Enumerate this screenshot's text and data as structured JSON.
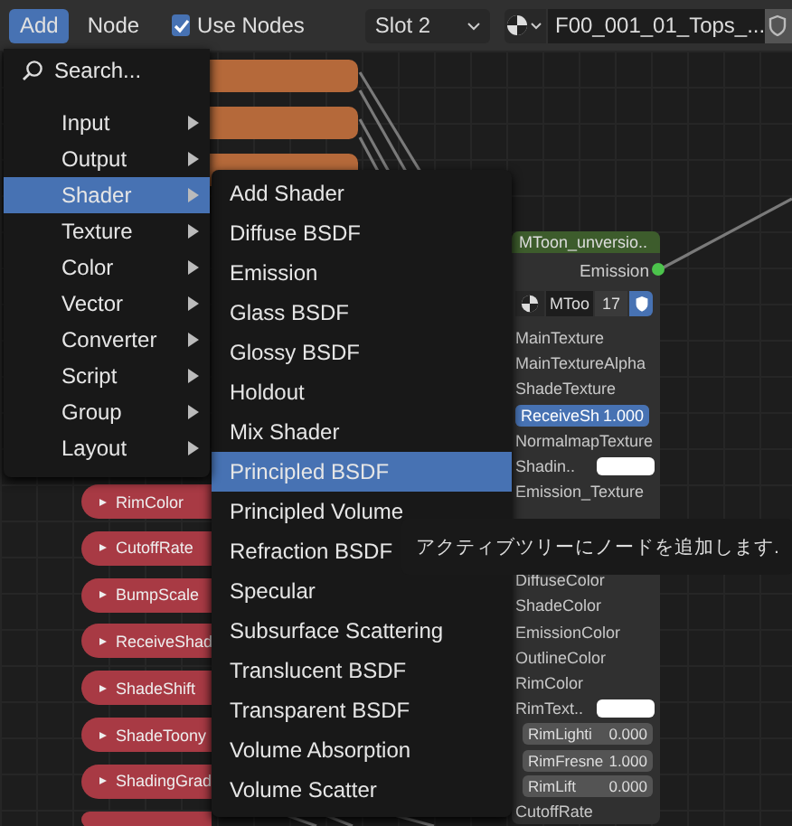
{
  "header": {
    "menus": [
      {
        "label": "Add",
        "selected": true
      },
      {
        "label": "Node",
        "selected": false
      }
    ],
    "use_nodes": {
      "label": "Use Nodes",
      "checked": true
    },
    "slot": "Slot 2",
    "material": "F00_001_01_Tops_..."
  },
  "add_menu": {
    "search": "Search...",
    "items": [
      {
        "label": "Input",
        "selected": false
      },
      {
        "label": "Output",
        "selected": false
      },
      {
        "label": "Shader",
        "selected": true
      },
      {
        "label": "Texture",
        "selected": false
      },
      {
        "label": "Color",
        "selected": false
      },
      {
        "label": "Vector",
        "selected": false
      },
      {
        "label": "Converter",
        "selected": false
      },
      {
        "label": "Script",
        "selected": false
      },
      {
        "label": "Group",
        "selected": false
      },
      {
        "label": "Layout",
        "selected": false
      }
    ]
  },
  "shader_menu": {
    "items": [
      {
        "label": "Add Shader",
        "selected": false
      },
      {
        "label": "Diffuse BSDF",
        "selected": false
      },
      {
        "label": "Emission",
        "selected": false
      },
      {
        "label": "Glass BSDF",
        "selected": false
      },
      {
        "label": "Glossy BSDF",
        "selected": false
      },
      {
        "label": "Holdout",
        "selected": false
      },
      {
        "label": "Mix Shader",
        "selected": false
      },
      {
        "label": "Principled BSDF",
        "selected": true
      },
      {
        "label": "Principled Volume",
        "selected": false
      },
      {
        "label": "Refraction BSDF",
        "selected": false
      },
      {
        "label": "Specular",
        "selected": false
      },
      {
        "label": "Subsurface Scattering",
        "selected": false
      },
      {
        "label": "Translucent BSDF",
        "selected": false
      },
      {
        "label": "Transparent BSDF",
        "selected": false
      },
      {
        "label": "Volume Absorption",
        "selected": false
      },
      {
        "label": "Volume Scatter",
        "selected": false
      }
    ]
  },
  "tooltip": "アクティブツリーにノードを追加します.",
  "group_node": {
    "title": "MToon_unversio..",
    "output": "Emission",
    "datablock": "MToo",
    "users": "17",
    "inputs_top": [
      {
        "kind": "socket",
        "label": "MainTexture"
      },
      {
        "kind": "socket",
        "label": "MainTextureAlpha"
      },
      {
        "kind": "socket",
        "label": "ShadeTexture"
      },
      {
        "kind": "slider",
        "label": "ReceiveSh",
        "value": "1.000",
        "level": 1
      },
      {
        "kind": "socket",
        "label": "NormalmapTexture"
      },
      {
        "kind": "color",
        "label": "Shadin.."
      },
      {
        "kind": "socket",
        "label": "Emission_Texture"
      }
    ],
    "inputs_bottom": [
      {
        "kind": "socket",
        "label": "DiffuseColor"
      },
      {
        "kind": "socket",
        "label": "ShadeColor"
      },
      {
        "kind": "socket",
        "label": "EmissionColor"
      },
      {
        "kind": "socket",
        "label": "OutlineColor"
      },
      {
        "kind": "socket",
        "label": "RimColor"
      },
      {
        "kind": "color",
        "label": "RimText.."
      },
      {
        "kind": "field",
        "label": "RimLighti",
        "value": "0.000"
      },
      {
        "kind": "field",
        "label": "RimFresne",
        "value": "1.000"
      },
      {
        "kind": "field",
        "label": "RimLift",
        "value": "0.000"
      },
      {
        "kind": "socket",
        "label": "CutoffRate"
      }
    ]
  },
  "value_nodes": [
    {
      "label": "RimColor"
    },
    {
      "label": "CutoffRate"
    },
    {
      "label": "BumpScale"
    },
    {
      "label": "ReceiveShad"
    },
    {
      "label": "ShadeShift"
    },
    {
      "label": "ShadeToony"
    },
    {
      "label": "ShadingGrad"
    }
  ]
}
